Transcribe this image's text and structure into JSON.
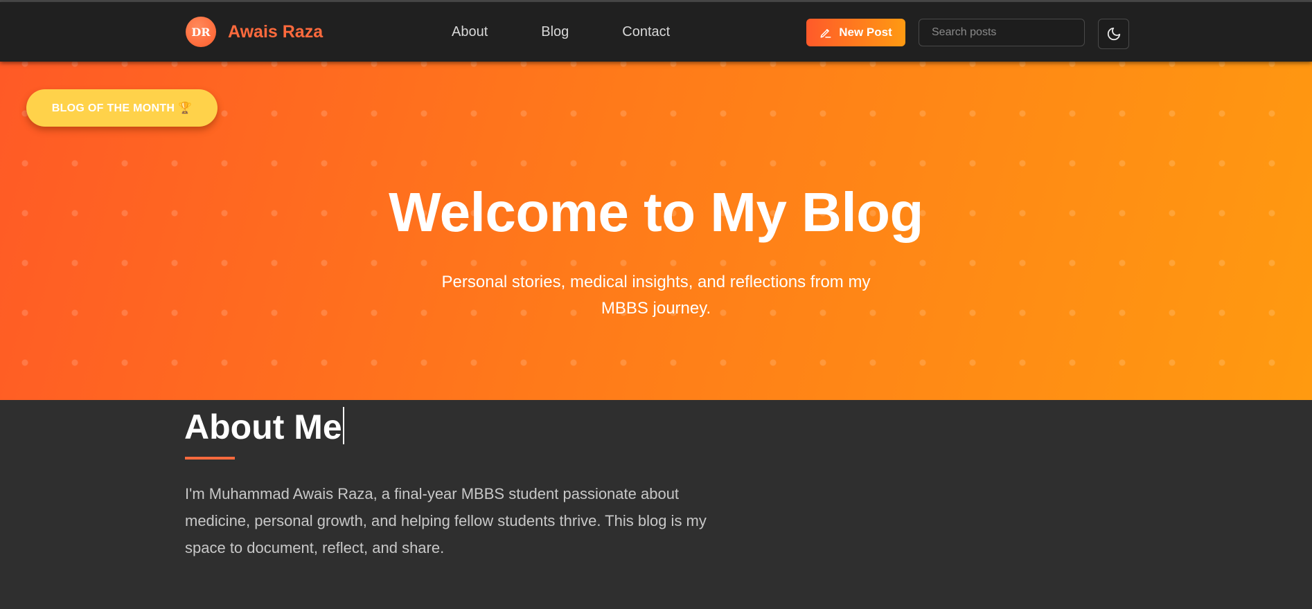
{
  "header": {
    "logo_text": "DR",
    "brand_name": "Awais Raza",
    "nav": [
      "About",
      "Blog",
      "Contact"
    ],
    "new_post_label": "New Post",
    "search_placeholder": "Search posts",
    "theme_icon": "moon-icon"
  },
  "hero": {
    "badge": "BLOG OF THE MONTH 🏆",
    "title": "Welcome to My Blog",
    "subtitle_line1": "Personal stories, medical insights, and reflections from my",
    "subtitle_line2": "MBBS journey."
  },
  "about": {
    "title": "About Me",
    "text_line1": "I'm Muhammad Awais Raza, a final-year MBBS student passionate about",
    "text_line2": "medicine, personal growth, and helping fellow students thrive. This blog is my",
    "text_line3": "space to document, reflect, and share."
  },
  "colors": {
    "accent": "#ff6a3d",
    "hero_start": "#ff5a26",
    "hero_end": "#ff9a10",
    "badge": "#ffd24a",
    "background": "#2f2f2f",
    "navbar": "#202020"
  }
}
